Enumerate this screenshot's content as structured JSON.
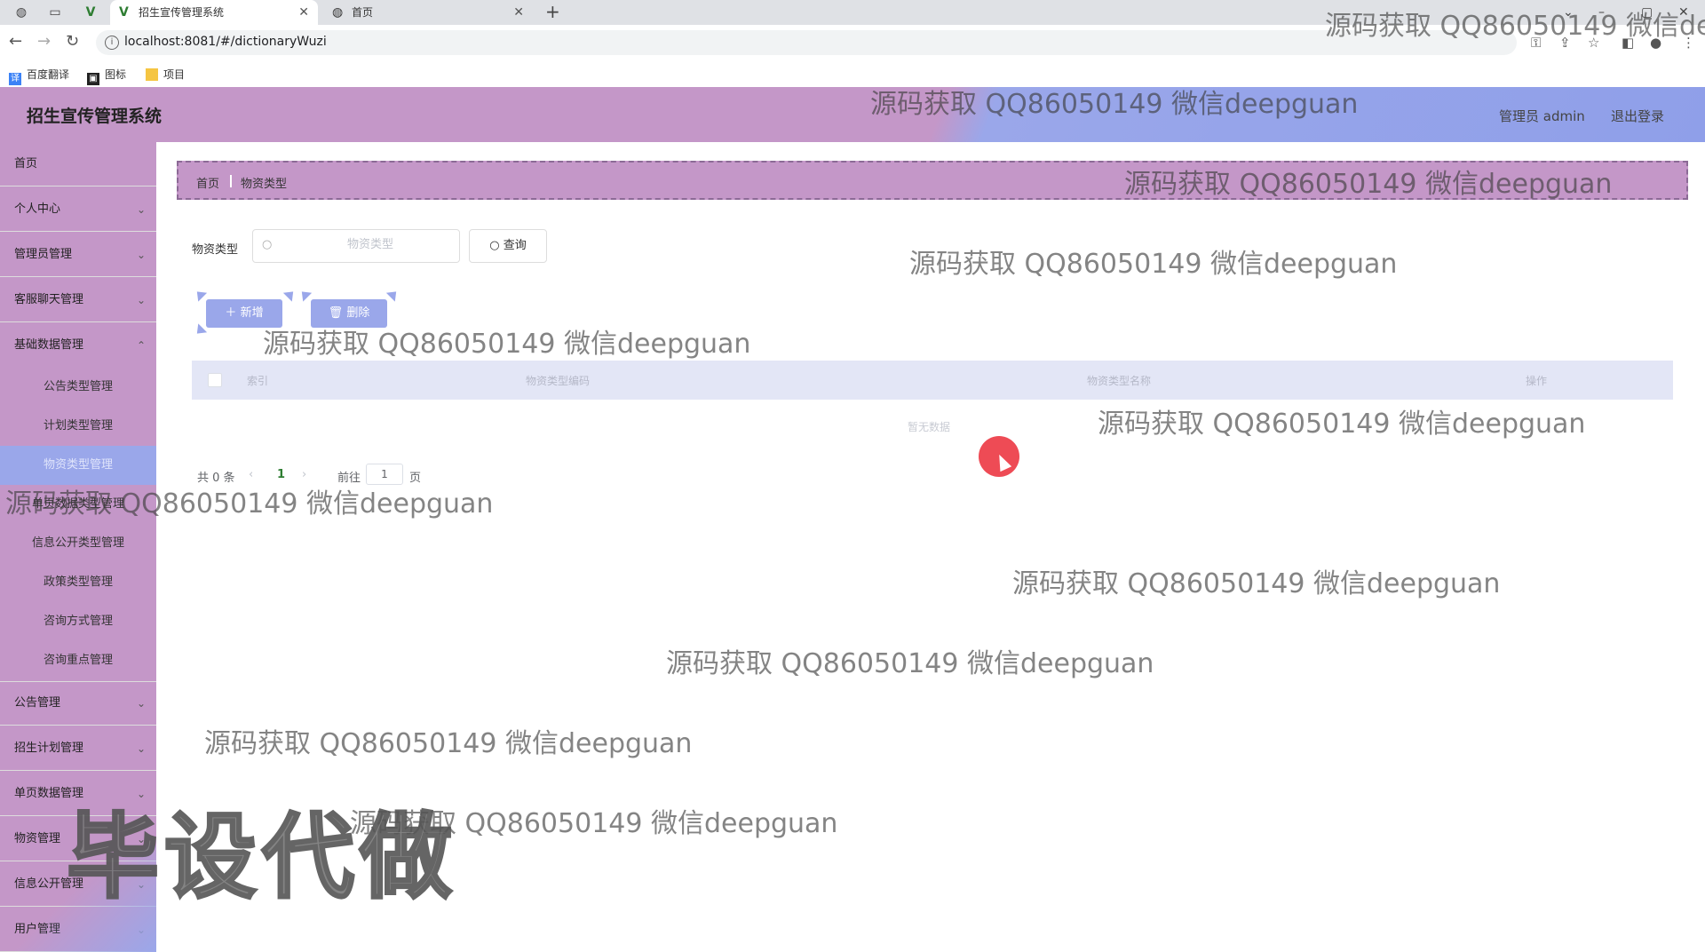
{
  "browser": {
    "tabs": [
      {
        "title": "招生宣传管理系统"
      },
      {
        "title": "首页"
      }
    ],
    "new_tab": "+",
    "url": "localhost:8081/#/dictionaryWuzi",
    "bookmarks": [
      "百度翻译",
      "图标",
      "项目"
    ]
  },
  "header": {
    "title": "招生宣传管理系统",
    "user": "管理员 admin",
    "logout": "退出登录"
  },
  "sidebar": {
    "items": [
      {
        "label": "首页",
        "has_chevron": false
      },
      {
        "label": "个人中心",
        "has_chevron": true
      },
      {
        "label": "管理员管理",
        "has_chevron": true
      },
      {
        "label": "客服聊天管理",
        "has_chevron": true
      },
      {
        "label": "基础数据管理",
        "has_chevron": true
      }
    ],
    "sub_items": [
      {
        "label": "公告类型管理"
      },
      {
        "label": "计划类型管理"
      },
      {
        "label": "物资类型管理",
        "active": true
      },
      {
        "label": "单页数据类型管理"
      },
      {
        "label": "信息公开类型管理"
      },
      {
        "label": "政策类型管理"
      },
      {
        "label": "咨询方式管理"
      },
      {
        "label": "咨询重点管理"
      }
    ],
    "items_after": [
      {
        "label": "公告管理"
      },
      {
        "label": "招生计划管理"
      },
      {
        "label": "单页数据管理"
      },
      {
        "label": "物资管理"
      },
      {
        "label": "信息公开管理"
      },
      {
        "label": "用户管理"
      }
    ]
  },
  "breadcrumb": {
    "home": "首页",
    "current": "物资类型"
  },
  "search": {
    "label": "物资类型",
    "placeholder": "物资类型",
    "button": "查询"
  },
  "actions": {
    "add": "新增",
    "delete": "删除"
  },
  "table": {
    "columns": [
      "索引",
      "物资类型编码",
      "物资类型名称",
      "操作"
    ],
    "empty_text": "暂无数据"
  },
  "pagination": {
    "total": "共 0 条",
    "prev": "‹",
    "page": "1",
    "next": "›",
    "goto": "前往",
    "goto_value": "1",
    "unit": "页"
  },
  "watermark": {
    "text": "源码获取 QQ86050149 微信deepguan",
    "text_cut": "源码获取 QQ86050149 微信de",
    "big": "毕设代做"
  },
  "colors": {
    "header_purple": "#c497c8",
    "accent_blue": "#9aa7ea",
    "cursor_red": "#ee4b55"
  }
}
